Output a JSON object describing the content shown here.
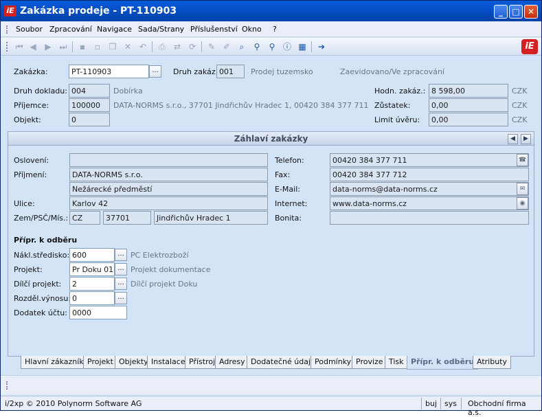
{
  "window": {
    "title": "Zakázka prodeje - PT-110903",
    "app_icon_text": "iE"
  },
  "menu": [
    "Soubor",
    "Zpracování",
    "Navigace",
    "Sada/Strany",
    "Příslušenství",
    "Okno",
    "?"
  ],
  "toolbar": {
    "icons": [
      "first-record-icon",
      "prev-record-icon",
      "next-record-icon",
      "last-record-icon",
      "save-icon",
      "new-icon",
      "copy-icon",
      "delete-icon",
      "undo-icon",
      "print-icon",
      "export-icon",
      "refresh-icon",
      "edit-icon",
      "edit2-icon",
      "search-icon",
      "zoom-icon",
      "filter-icon",
      "info-icon",
      "grid-icon",
      "goto-icon"
    ],
    "logo_text": "iE"
  },
  "header": {
    "zakazka_label": "Zakázka:",
    "zakazka_value": "PT-110903",
    "druh_zakaz_label": "Druh zakáz.:",
    "druh_zakaz_value": "001",
    "druh_zakaz_desc": "Prodej tuzemsko",
    "status_text": "Zaevidovano/Ve zpracování",
    "druh_dokladu_label": "Druh dokladu:",
    "druh_dokladu_value": "004",
    "druh_dokladu_desc": "Dobírka",
    "prijemce_label": "Příjemce:",
    "prijemce_value": "100000",
    "prijemce_desc": "DATA-NORMS s.r.o., 37701 Jindřichův Hradec 1, 00420 384 377 711",
    "objekt_label": "Objekt:",
    "objekt_value": "0",
    "hodn_label": "Hodn. zakáz.:",
    "hodn_value": "8 598,00",
    "zustatek_label": "Zůstatek:",
    "zustatek_value": "0,00",
    "limit_label": "Limit úvěru:",
    "limit_value": "0,00",
    "currency": "CZK"
  },
  "panel": {
    "title": "Záhlaví zakázky",
    "osloveni_label": "Oslovení:",
    "osloveni_value": "",
    "prijmeni_label": "Příjmení:",
    "prijmeni_value": "DATA-NORMS s.r.o.",
    "prijmeni_value2": "Nežárecké předměstí",
    "ulice_label": "Ulice:",
    "ulice_value": "Karlov 42",
    "zem_label": "Zem/PSČ/Mís.:",
    "zem_value": "CZ",
    "psc_value": "37701",
    "misto_value": "Jindřichův Hradec 1",
    "telefon_label": "Telefon:",
    "telefon_value": "00420 384 377 711",
    "fax_label": "Fax:",
    "fax_value": "00420 384 377 712",
    "email_label": "E-Mail:",
    "email_value": "data-norms@data-norms.cz",
    "internet_label": "Internet:",
    "internet_value": "www.data-norms.cz",
    "bonita_label": "Bonita:",
    "bonita_value": "",
    "section_title": "Přípr. k odběru",
    "nakl_label": "Nákl.středisko:",
    "nakl_value": "600",
    "nakl_desc": "PC Elektrozboží",
    "projekt_label": "Projekt:",
    "projekt_value": "Pr Doku 01",
    "projekt_desc": "Projekt dokumentace",
    "dilci_label": "Dílčí projekt:",
    "dilci_value": "2",
    "dilci_desc": "Dílčí projekt Doku",
    "rozdel_label": "Rozděl.výnosu:",
    "rozdel_value": "0",
    "dodatek_label": "Dodatek účtu:",
    "dodatek_value": "0000"
  },
  "tabs": [
    "Hlavní zákazník",
    "Projekt",
    "Objekty",
    "Instalace",
    "Přístroj",
    "Adresy",
    "Dodatečné údaje",
    "Podmínky",
    "Provize",
    "Tisk",
    "Přípr. k odběru",
    "Atributy"
  ],
  "active_tab": "Přípr. k odběru",
  "status": {
    "copyright": "i/2xp © 2010 Polynorm Software AG",
    "user": "buj",
    "db": "sys",
    "company": "Obchodní firma a.s."
  }
}
